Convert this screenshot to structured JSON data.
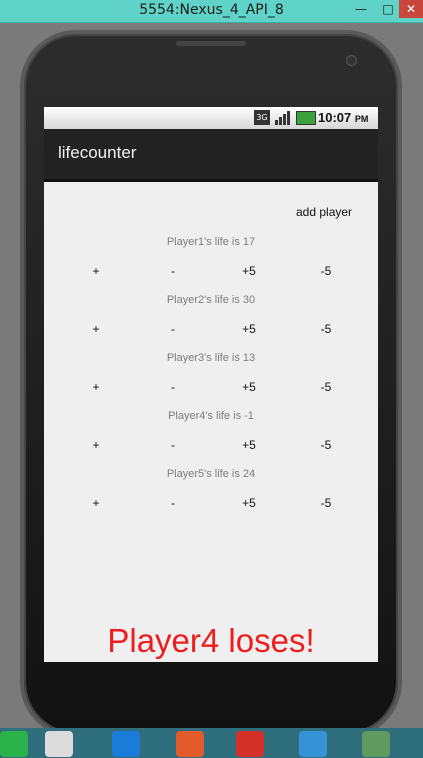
{
  "window": {
    "title": "5554:Nexus_4_API_8",
    "min_label": "—",
    "max_label": "□",
    "close_label": "✕"
  },
  "status": {
    "network": "3G",
    "time": "10:07",
    "ampm": "PM"
  },
  "app": {
    "title": "lifecounter",
    "add_player": "add player",
    "controls": {
      "plus": "+",
      "minus": "-",
      "plus5": "+5",
      "minus5": "-5"
    },
    "players": [
      {
        "label": "Player1's life is 17"
      },
      {
        "label": "Player2's life is 30"
      },
      {
        "label": "Player3's life is 13"
      },
      {
        "label": "Player4's life is -1"
      },
      {
        "label": "Player5's life is 24"
      }
    ],
    "message": "Player4 loses!"
  },
  "colors": {
    "lose_message": "#ee1d1d",
    "actionbar": "#222222",
    "screen_bg": "#efefef"
  },
  "icons": {
    "taskbar": [
      "start-icon",
      "chrome-icon",
      "windows-store-icon",
      "angry-bird-icon",
      "music-icon",
      "media-player-icon",
      "android-studio-icon"
    ]
  }
}
